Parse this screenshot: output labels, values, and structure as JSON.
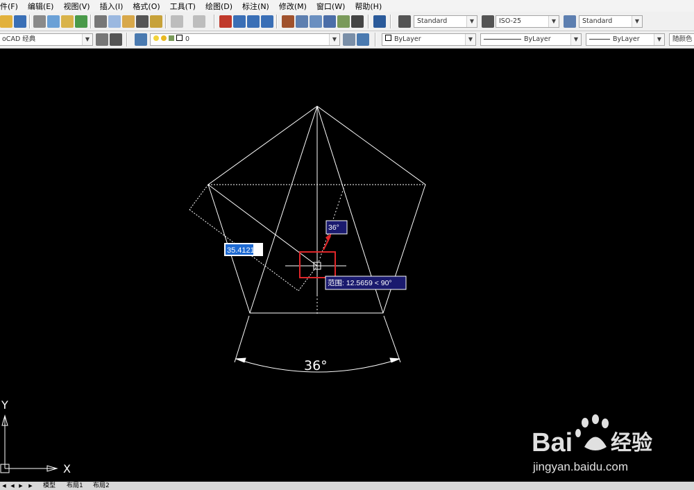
{
  "menu": [
    "件(F)",
    "编辑(E)",
    "视图(V)",
    "插入(I)",
    "格式(O)",
    "工具(T)",
    "绘图(D)",
    "标注(N)",
    "修改(M)",
    "窗口(W)",
    "帮助(H)"
  ],
  "toolbar": {
    "text_style": "Standard",
    "dim_style": "ISO-25",
    "table_style": "Standard",
    "workspace": "oCAD 经典",
    "layer": "0",
    "color": "ByLayer",
    "linetype": "ByLayer",
    "lineweight": "ByLayer",
    "plot_style": "随颜色"
  },
  "drawing": {
    "length_input": "35.4121",
    "angle_tooltip": "36°",
    "polar_tooltip": "范围: 12.5659 < 90°",
    "angle_dimension": "36°",
    "ucs_x": "X",
    "ucs_y": "Y"
  },
  "tabs": [
    "模型",
    "布局1",
    "布局2"
  ],
  "watermark": {
    "brand": "Bai",
    "brand2": "经验",
    "url": "jingyan.baidu.com"
  },
  "colors": {
    "background": "#000000",
    "lines": "#ffffff",
    "tooltip": "#1a1a6e",
    "highlight": "#e0262a",
    "input_box": "#ffffff",
    "input_selected": "#1e6ad2"
  }
}
